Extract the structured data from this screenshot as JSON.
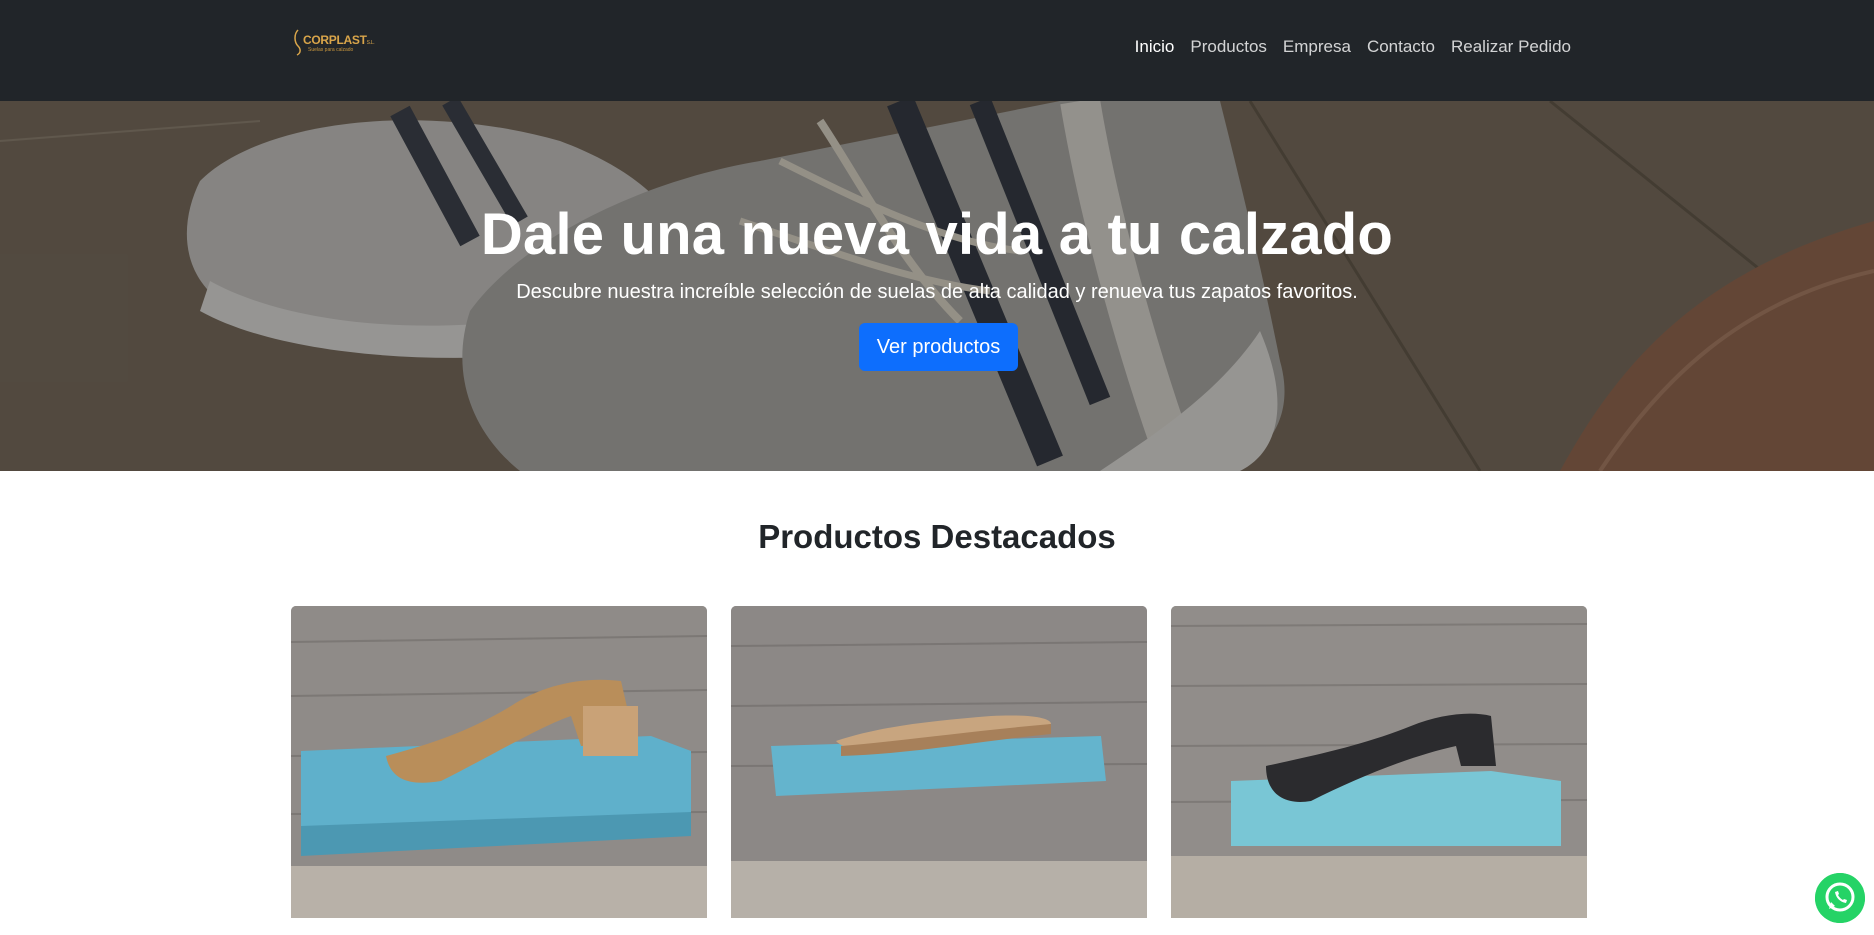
{
  "brand": {
    "name": "CORPLAST",
    "suffix": "S.L.",
    "tagline": "Suelas para calzado",
    "color": "#d9a54a"
  },
  "nav": {
    "items": [
      {
        "label": "Inicio",
        "active": true
      },
      {
        "label": "Productos",
        "active": false
      },
      {
        "label": "Empresa",
        "active": false
      },
      {
        "label": "Contacto",
        "active": false
      },
      {
        "label": "Realizar Pedido",
        "active": false
      }
    ]
  },
  "hero": {
    "title": "Dale una nueva vida a tu calzado",
    "subtitle": "Descubre nuestra increíble selección de suelas de alta calidad y renueva tus zapatos favoritos.",
    "button_label": "Ver productos",
    "button_color": "#0d6efd"
  },
  "products": {
    "title": "Productos Destacados",
    "items": [
      {
        "image": "tan-heel-sole-on-blue-shelf"
      },
      {
        "image": "beige-flat-sole-on-blue-shelf"
      },
      {
        "image": "black-sole-on-blue-shelf"
      }
    ]
  },
  "whatsapp": {
    "icon": "whatsapp-icon",
    "color": "#25d366"
  }
}
